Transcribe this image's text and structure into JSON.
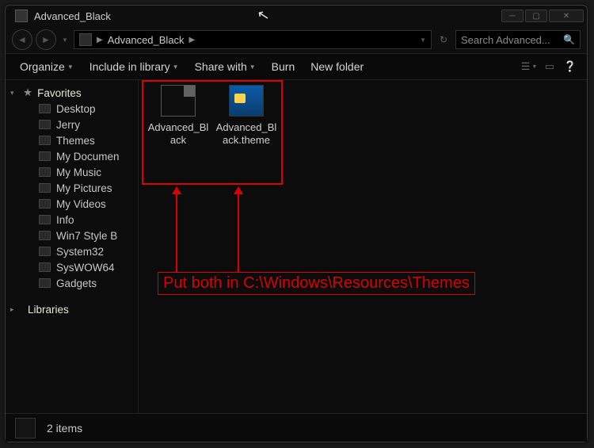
{
  "titlebar": {
    "title": "Advanced_Black"
  },
  "address": {
    "crumb": "Advanced_Black"
  },
  "search": {
    "placeholder": "Search Advanced..."
  },
  "toolbar": {
    "organize": "Organize",
    "include": "Include in library",
    "share": "Share with",
    "burn": "Burn",
    "newfolder": "New folder"
  },
  "sidebar": {
    "favorites_label": "Favorites",
    "libraries_label": "Libraries",
    "items": [
      {
        "label": "Desktop"
      },
      {
        "label": "Jerry"
      },
      {
        "label": "Themes"
      },
      {
        "label": "My Documen"
      },
      {
        "label": "My Music"
      },
      {
        "label": "My Pictures"
      },
      {
        "label": "My Videos"
      },
      {
        "label": "Info"
      },
      {
        "label": "Win7 Style B"
      },
      {
        "label": "System32"
      },
      {
        "label": "SysWOW64"
      },
      {
        "label": "Gadgets"
      }
    ]
  },
  "content": {
    "files": [
      {
        "name": "Advanced_Black"
      },
      {
        "name": "Advanced_Black.theme"
      }
    ]
  },
  "annotation": {
    "text": "Put both in C:\\Windows\\Resources\\Themes"
  },
  "statusbar": {
    "count": "2 items"
  }
}
